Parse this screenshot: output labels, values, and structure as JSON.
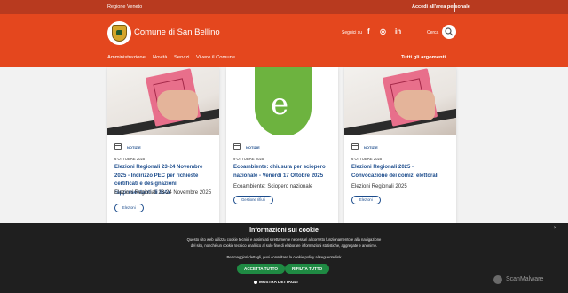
{
  "topbar": {
    "region": "Regione Veneto",
    "reserved_area": "Accedi all'area personale"
  },
  "header": {
    "title": "Comune di San Bellino",
    "follow_label": "Seguici su",
    "search_label": "Cerca",
    "social": [
      {
        "name": "facebook-icon",
        "glyph": "f"
      },
      {
        "name": "instagram-icon",
        "glyph": "◎"
      },
      {
        "name": "linkedin-icon",
        "glyph": "in"
      }
    ]
  },
  "nav": {
    "items": [
      "Amministrazione",
      "Novità",
      "Servizi",
      "Vivere il Comune"
    ],
    "all_topics": "Tutti gli argomenti"
  },
  "cards": [
    {
      "tag": "NOTIZIE",
      "date": "6 OTTOBRE 2025",
      "title": "Elezioni Regionali 23-24 Novembre 2025 - Indirizzo PEC per richieste certificati e designazioni rappresentanti di lista",
      "description": "Elezioni Regionali 23-24 Novembre 2025",
      "pill": "Elezioni"
    },
    {
      "tag": "NOTIZIE",
      "date": "9 OTTOBRE 2025",
      "title": "Ecoambiente: chiusura per sciopero nazionale - Venerdì 17 Ottobre 2025",
      "description": "Ecoambiente: Sciopero nazionale",
      "pill": "Gestione rifiuti"
    },
    {
      "tag": "NOTIZIE",
      "date": "6 OTTOBRE 2025",
      "title": "Elezioni Regionali 2025 - Convocazione dei comizi elettorali",
      "description": "Elezioni Regionali 2025",
      "pill": "Elezioni"
    }
  ],
  "cookie": {
    "title": "Informazioni sui cookie",
    "text": "Questo sito web utilizza cookie tecnici e assimilati strettamente necessari al corretto funzionamento e alla navigazione del sito, nonché un cookie tecnico analitico al solo fine di elaborare informazioni statistiche, aggregate e anonime.",
    "more": "Per maggiori dettagli, puoi consultare la cookie policy al seguente link",
    "accept": "ACCETTA TUTTO",
    "reject": "RIFIUTA TUTTO",
    "details": "MOSTRA DETTAGLI",
    "close": "×"
  },
  "watermark": "ScanMalware"
}
